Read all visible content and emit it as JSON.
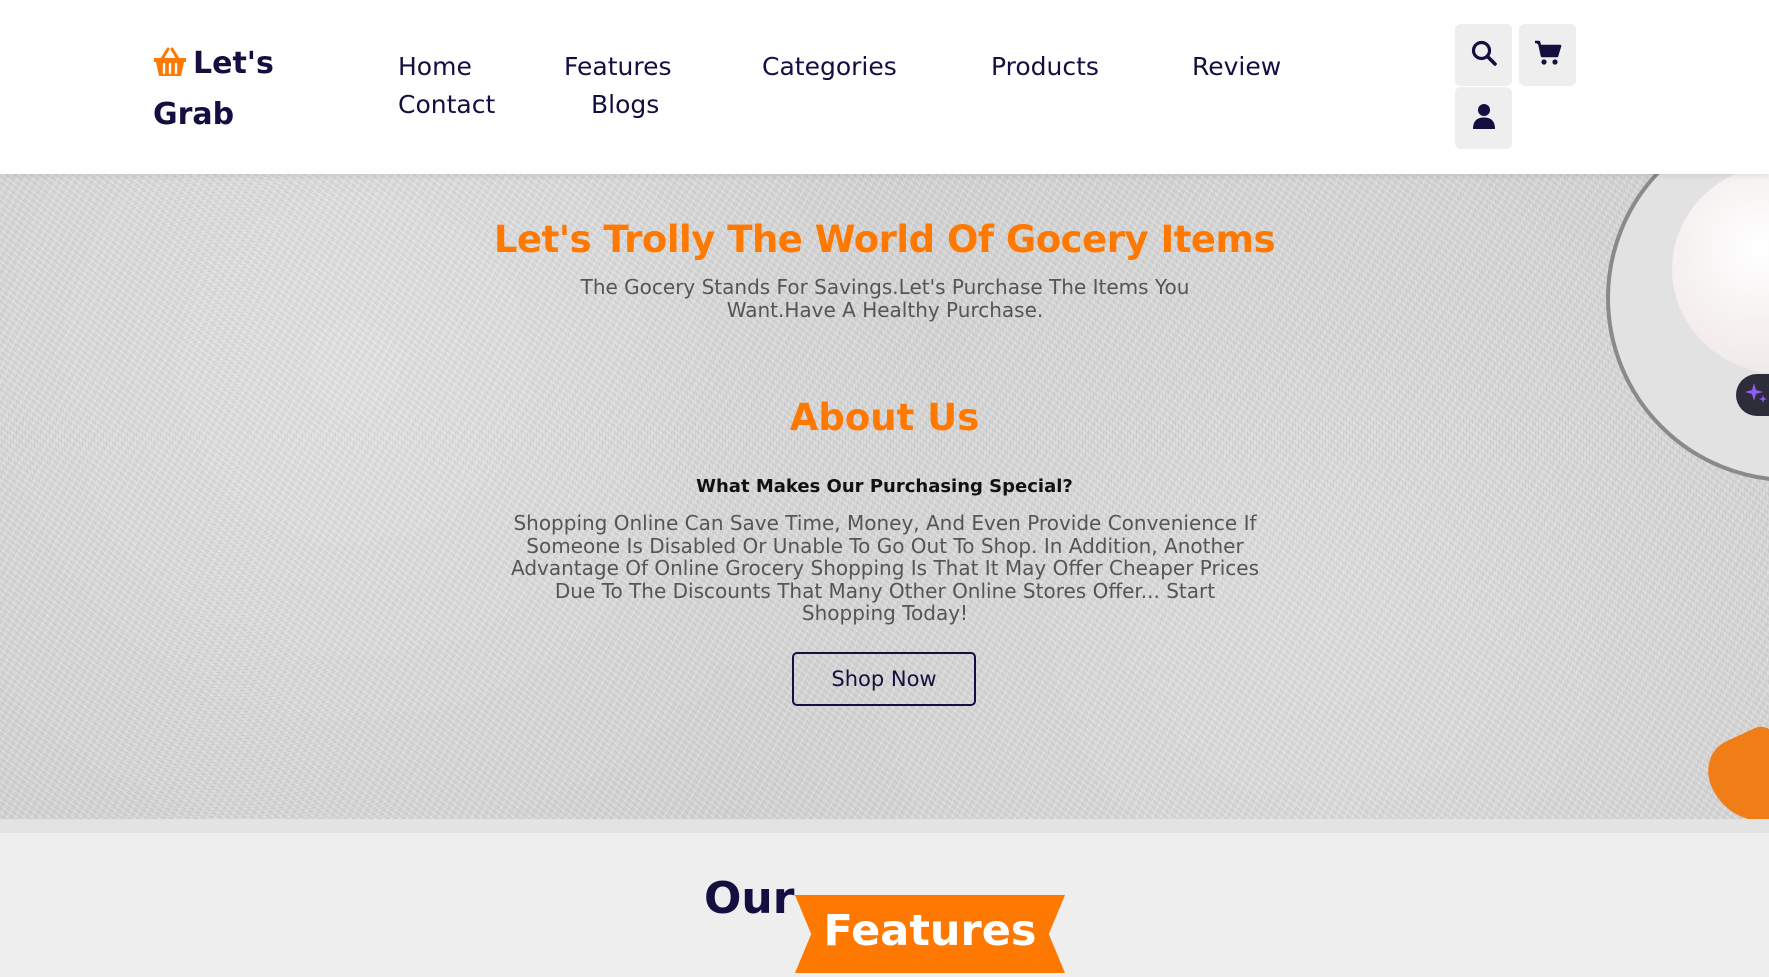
{
  "header": {
    "logo_line1": "Let's",
    "logo_line2": "Grab",
    "nav": {
      "home": "Home",
      "features": "Features",
      "categories": "Categories",
      "products": "Products",
      "review": "Review",
      "contact": "Contact",
      "blogs": "Blogs"
    }
  },
  "hero": {
    "title": "Let's Trolly The World Of Gocery Items",
    "subtitle_line1": "The Gocery Stands For Savings.Let's Purchase The Items You",
    "subtitle_line2": "Want.Have A Healthy Purchase."
  },
  "about": {
    "title": "About Us",
    "question": "What Makes Our Purchasing Special?",
    "text": "Shopping Online Can Save Time, Money, And Even Provide Convenience If Someone Is Disabled Or Unable To Go Out To Shop. In Addition, Another Advantage Of Online Grocery Shopping Is That It May Offer Cheaper Prices Due To The Discounts That Many Other Online Stores Offer... Start Shopping Today!",
    "button": "Shop Now"
  },
  "features": {
    "heading_prefix": "Our",
    "heading_highlight": "Features"
  },
  "colors": {
    "accent": "#ff7800",
    "dark": "#130f40",
    "icon_bg": "#eeeeee"
  },
  "icons": [
    "basket-icon",
    "search-icon",
    "cart-icon",
    "user-icon",
    "sparkle-icon"
  ]
}
